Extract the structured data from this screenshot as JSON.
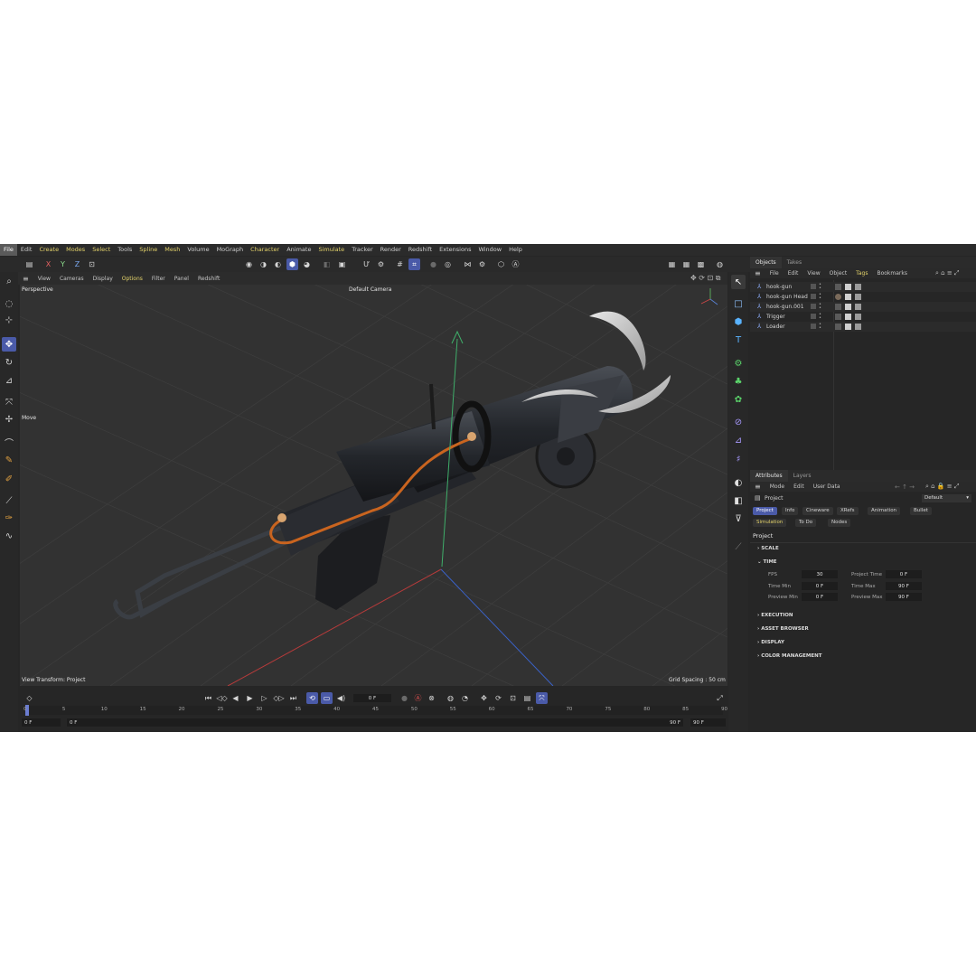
{
  "menubar": [
    "File",
    "Edit",
    "Create",
    "Modes",
    "Select",
    "Tools",
    "Spline",
    "Mesh",
    "Volume",
    "MoGraph",
    "Character",
    "Animate",
    "Simulate",
    "Tracker",
    "Render",
    "Redshift",
    "Extensions",
    "Window",
    "Help"
  ],
  "toolbar": {
    "axis_x": "X",
    "axis_y": "Y",
    "axis_z": "Z"
  },
  "viewport": {
    "menu": [
      "View",
      "Cameras",
      "Display",
      "Options",
      "Filter",
      "Panel",
      "Redshift"
    ],
    "projection": "Perspective",
    "camera": "Default Camera",
    "tool": "Move",
    "view_transform": "View Transform: Project",
    "grid_spacing": "Grid Spacing : 50 cm"
  },
  "timeline": {
    "current_frame": "0 F",
    "ticks": [
      "0",
      "5",
      "10",
      "15",
      "20",
      "25",
      "30",
      "35",
      "40",
      "45",
      "50",
      "55",
      "60",
      "65",
      "70",
      "75",
      "80",
      "85",
      "90"
    ],
    "start": "0 F",
    "preview_start": "0 F",
    "preview_end": "90 F",
    "end": "90 F"
  },
  "objects_panel": {
    "tabs": [
      "Objects",
      "Takes"
    ],
    "menu": [
      "File",
      "Edit",
      "View",
      "Object",
      "Tags",
      "Bookmarks"
    ],
    "items": [
      "hook-gun",
      "hook-gun Head",
      "hook-gun.001",
      "Trigger",
      "Loader"
    ]
  },
  "attributes_panel": {
    "tabs": [
      "Attributes",
      "Layers"
    ],
    "menu": [
      "Mode",
      "Edit",
      "User Data"
    ],
    "object_label": "Project",
    "preset": "Default",
    "chips_row1": [
      "Project",
      "Info",
      "Cineware",
      "XRefs",
      "Animation",
      "Bullet"
    ],
    "chips_row2": [
      "Simulation",
      "To Do",
      "Nodes"
    ],
    "heading": "Project",
    "sections": {
      "scale": "SCALE",
      "time": "TIME",
      "execution": "EXECUTION",
      "asset_browser": "ASSET BROWSER",
      "display": "DISPLAY",
      "color_management": "COLOR MANAGEMENT"
    },
    "time_fields": {
      "fps_label": "FPS",
      "fps": "30",
      "project_time_label": "Project Time",
      "project_time": "0 F",
      "time_min_label": "Time Min",
      "time_min": "0 F",
      "time_max_label": "Time Max",
      "time_max": "90 F",
      "preview_min_label": "Preview Min",
      "preview_min": "0 F",
      "preview_max_label": "Preview Max",
      "preview_max": "90 F"
    }
  },
  "colors": {
    "accent": "#4a5aa8",
    "highlight_text": "#e3d26a",
    "background": "#262626",
    "viewport": "#323232"
  }
}
